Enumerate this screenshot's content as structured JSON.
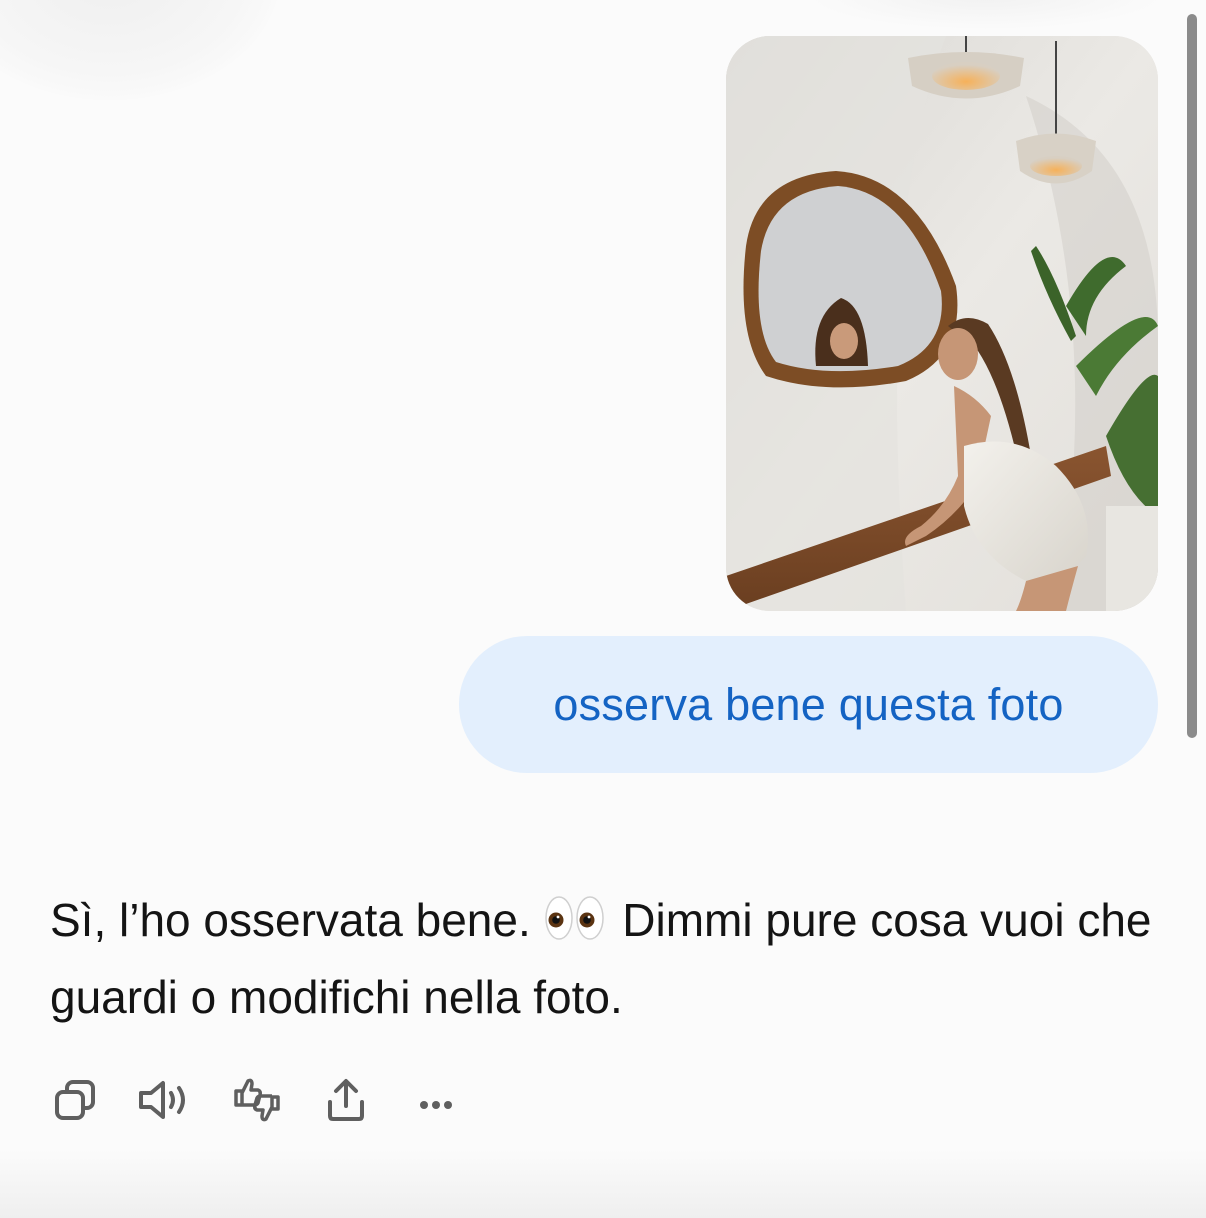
{
  "conversation": {
    "user_image": {
      "icon": "photo-attachment",
      "accent": "#e7e4df"
    },
    "user_message": "osserva bene questa foto",
    "assistant_reply": {
      "part1": "Sì, l’ho osservata bene. ",
      "emoji": "eyes-emoji",
      "part2": " Dimmi pure cosa vuoi che guardi o modifichi nella foto."
    }
  },
  "actions": [
    {
      "name": "copy",
      "icon": "copy-icon"
    },
    {
      "name": "read-aloud",
      "icon": "speaker-icon"
    },
    {
      "name": "feedback",
      "icon": "thumbs-icon"
    },
    {
      "name": "share",
      "icon": "share-icon"
    },
    {
      "name": "more",
      "icon": "more-icon"
    }
  ],
  "colors": {
    "background": "#fbfbfb",
    "bubble": "#e3effd",
    "bubble_text": "#1463c3",
    "text": "#141414",
    "icon": "#5f5f5f",
    "scrollbar": "#8b8b8b"
  }
}
